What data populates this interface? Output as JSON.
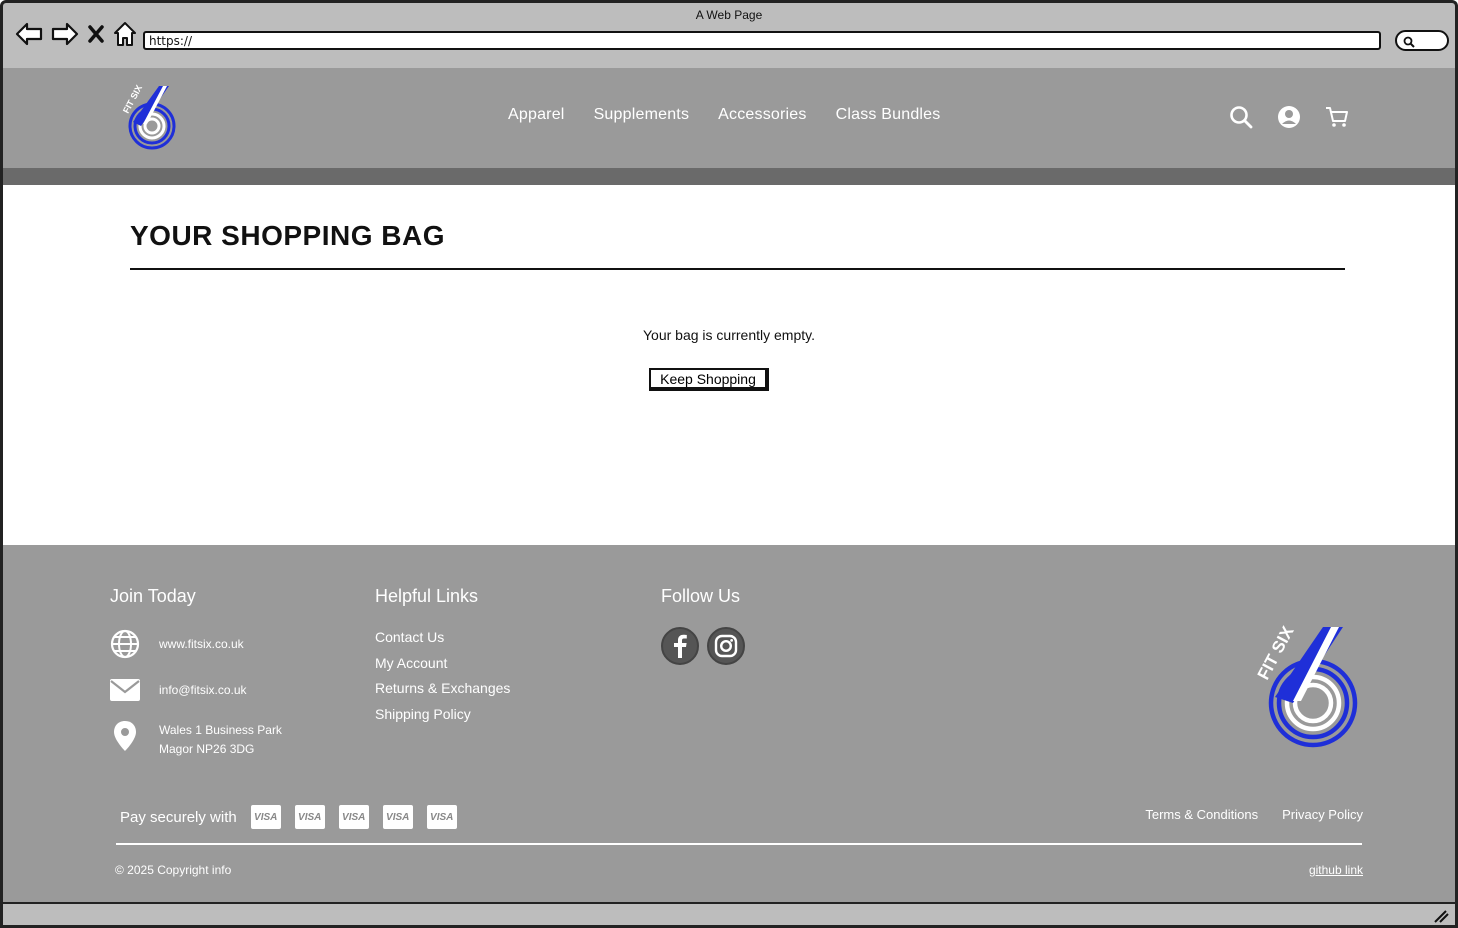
{
  "browser": {
    "title": "A Web Page",
    "url": "https://",
    "icons": [
      "back-icon",
      "forward-icon",
      "close-icon",
      "home-icon",
      "search-icon"
    ]
  },
  "header": {
    "logo_alt": "FIT SIX",
    "nav": [
      "Apparel",
      "Supplements",
      "Accessories",
      "Class Bundles"
    ],
    "icons": [
      "search-icon",
      "account-icon",
      "cart-icon"
    ]
  },
  "main": {
    "title": "YOUR SHOPPING BAG",
    "empty_message": "Your bag is currently empty.",
    "keep_shopping": "Keep Shopping"
  },
  "footer": {
    "join": {
      "title": "Join Today",
      "website": "www.fitsix.co.uk",
      "email": "info@fitsix.co.uk",
      "address_line1": "Wales 1 Business Park",
      "address_line2": "Magor NP26 3DG"
    },
    "helpful": {
      "title": "Helpful Links",
      "links": [
        "Contact Us",
        "My Account",
        "Returns & Exchanges",
        "Shipping Policy"
      ]
    },
    "follow": {
      "title": "Follow Us",
      "icons": [
        "facebook-icon",
        "instagram-icon"
      ]
    },
    "pay_label": "Pay securely with",
    "cards": [
      "VISA",
      "VISA",
      "VISA",
      "VISA",
      "VISA"
    ],
    "terms": "Terms & Conditions",
    "privacy": "Privacy Policy",
    "copyright": "© 2025 Copyright info",
    "github": "github link"
  },
  "colors": {
    "header_bg": "#9a9a9a",
    "stripe": "#6a6a6a",
    "footer_bg": "#9a9a9a",
    "logo_blue": "#1f2fd8"
  }
}
